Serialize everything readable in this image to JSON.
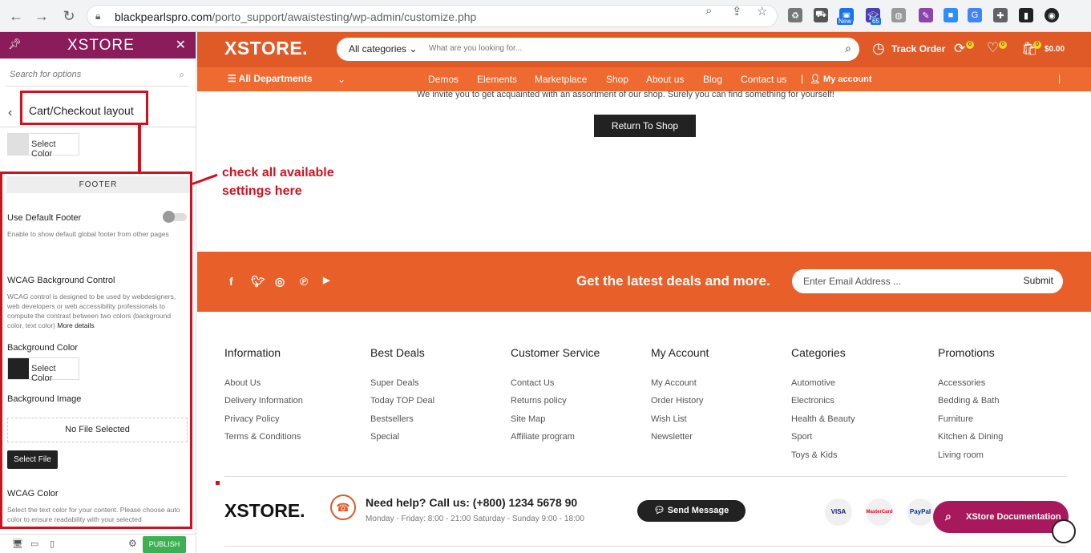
{
  "browser": {
    "url_host": "blackpearlspro.com",
    "url_path": "/porto_support/awaistesting/wp-admin/customize.php",
    "new_badge": "New",
    "ext_count": "65"
  },
  "sidebar": {
    "brand": "XSTORE",
    "search_placeholder": "Search for options",
    "section_title": "Cart/Checkout layout",
    "select_color_label": "Select Color",
    "footer_heading": "FOOTER",
    "use_default_footer": "Use Default Footer",
    "use_default_footer_desc": "Enable to show default global footer from other pages",
    "wcag_bg_control": "WCAG Background Control",
    "wcag_desc": "WCAG control is designed to be used by webdesigners, web developers or web accessibility professionals to compute the contrast between two colors (background color, text color)",
    "more_details": "More details",
    "background_color": "Background Color",
    "background_image": "Background Image",
    "no_file": "No File Selected",
    "select_file": "Select File",
    "wcag_color": "WCAG Color",
    "wcag_color_desc": "Select the text color for your content. Please choose auto color to ensure readability with your selected",
    "publish": "PUBLISH",
    "bg_color_swatch": "#222222",
    "top_swatch": "#e0e0e0"
  },
  "annotation": {
    "line1": "check all available",
    "line2": "settings here"
  },
  "site": {
    "logo": "XSTORE.",
    "search_category": "All categories",
    "search_placeholder": "What are you looking for...",
    "track_order": "Track Order",
    "cart_total": "$0.00",
    "badge": "0",
    "all_departments": "All Departments",
    "nav": [
      "Demos",
      "Elements",
      "Marketplace",
      "Shop",
      "About us",
      "Blog",
      "Contact us"
    ],
    "my_account": "My account",
    "intro_text": "We invite you to get acquainted with an assortment of our shop. Surely you can find something for yourself!",
    "return_btn": "Return To Shop",
    "newsletter_text": "Get the latest deals and more.",
    "email_placeholder": "Enter Email Address ...",
    "submit": "Submit",
    "columns": [
      {
        "title": "Information",
        "links": [
          "About Us",
          "Delivery Information",
          "Privacy Policy",
          "Terms & Conditions"
        ]
      },
      {
        "title": "Best Deals",
        "links": [
          "Super Deals",
          "Today TOP Deal",
          "Bestsellers",
          "Special"
        ]
      },
      {
        "title": "Customer Service",
        "links": [
          "Contact Us",
          "Returns policy",
          "Site Map",
          "Affiliate program"
        ]
      },
      {
        "title": "My Account",
        "links": [
          "My Account",
          "Order History",
          "Wish List",
          "Newsletter"
        ]
      },
      {
        "title": "Categories",
        "links": [
          "Automotive",
          "Electronics",
          "Health & Beauty",
          "Sport",
          "Toys & Kids"
        ]
      },
      {
        "title": "Promotions",
        "links": [
          "Accessories",
          "Bedding & Bath",
          "Furniture",
          "Kitchen & Dining",
          "Living room"
        ]
      }
    ],
    "footer_logo": "XSTORE.",
    "help_title": "Need help? Call us: (+800) 1234 5678 90",
    "help_hours": "Monday - Friday: 8:00 - 21:00 Saturday - Sunday 9:00 - 18:00",
    "send_message": "Send Message",
    "payments": [
      "VISA",
      "MasterCard",
      "PayPal"
    ],
    "doc_button": "XStore Documentation"
  }
}
